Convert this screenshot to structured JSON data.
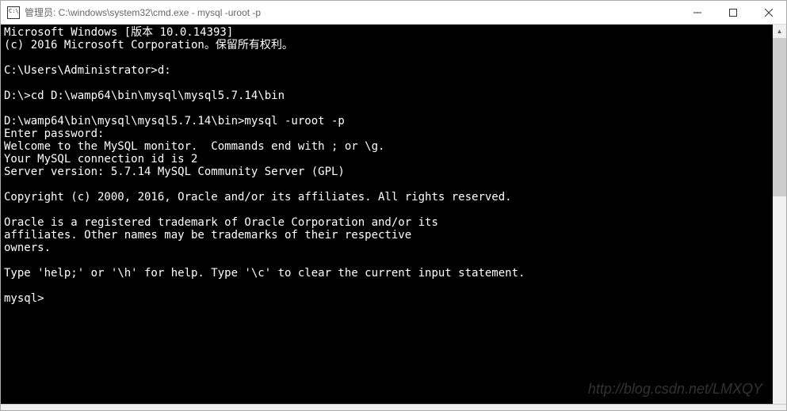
{
  "titlebar": {
    "text": "管理员: C:\\windows\\system32\\cmd.exe - mysql  -uroot -p"
  },
  "terminal": {
    "lines": [
      "Microsoft Windows [版本 10.0.14393]",
      "(c) 2016 Microsoft Corporation。保留所有权利。",
      "",
      "C:\\Users\\Administrator>d:",
      "",
      "D:\\>cd D:\\wamp64\\bin\\mysql\\mysql5.7.14\\bin",
      "",
      "D:\\wamp64\\bin\\mysql\\mysql5.7.14\\bin>mysql -uroot -p",
      "Enter password:",
      "Welcome to the MySQL monitor.  Commands end with ; or \\g.",
      "Your MySQL connection id is 2",
      "Server version: 5.7.14 MySQL Community Server (GPL)",
      "",
      "Copyright (c) 2000, 2016, Oracle and/or its affiliates. All rights reserved.",
      "",
      "Oracle is a registered trademark of Oracle Corporation and/or its",
      "affiliates. Other names may be trademarks of their respective",
      "owners.",
      "",
      "Type 'help;' or '\\h' for help. Type '\\c' to clear the current input statement.",
      "",
      "mysql>"
    ]
  },
  "watermark": "http://blog.csdn.net/LMXQY"
}
